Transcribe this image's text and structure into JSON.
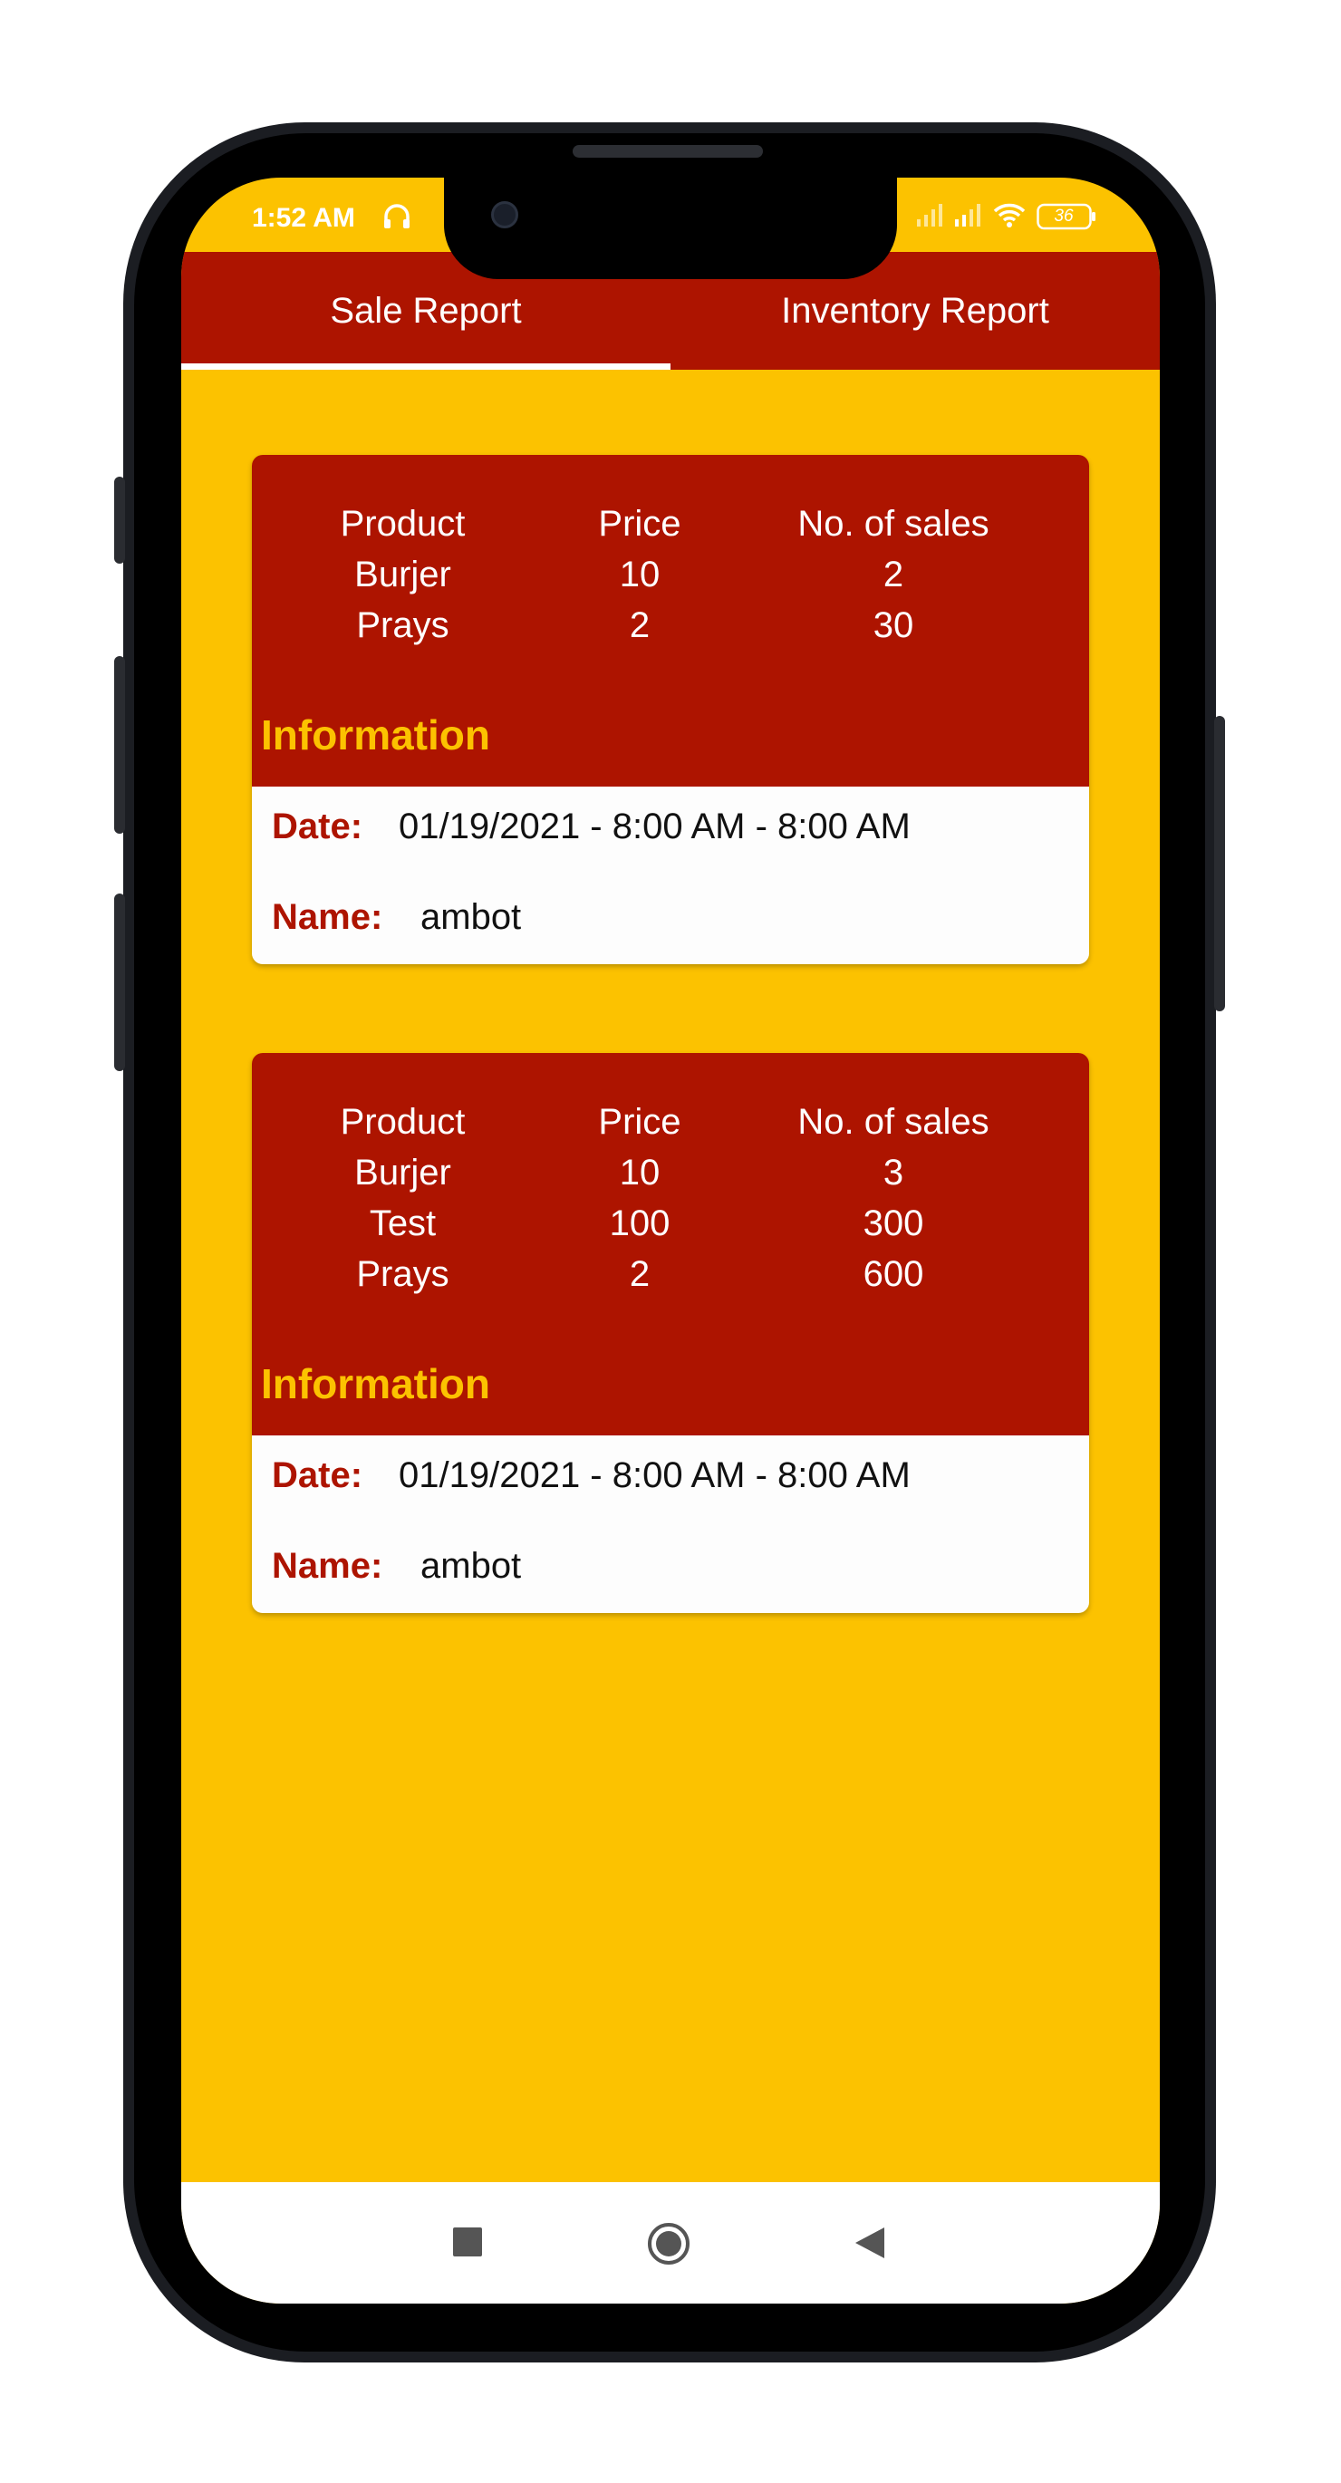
{
  "status_bar": {
    "time": "1:52 AM",
    "battery": "36",
    "icons": [
      "headphone-icon",
      "signal-icon",
      "signal-icon",
      "wifi-icon",
      "battery-icon"
    ]
  },
  "tabs": [
    {
      "label": "Sale Report",
      "selected": true
    },
    {
      "label": "Inventory Report",
      "selected": false
    }
  ],
  "reports": [
    {
      "headers": [
        "Product",
        "Price",
        "No. of sales"
      ],
      "rows": [
        [
          "Burjer",
          "10",
          "2"
        ],
        [
          "Prays",
          "2",
          "30"
        ]
      ],
      "info_title": "Information",
      "date_label": "Date:",
      "date_value": "01/19/2021 - 8:00 AM - 8:00 AM",
      "name_label": "Name:",
      "name_value": "ambot"
    },
    {
      "headers": [
        "Product",
        "Price",
        "No. of sales"
      ],
      "rows": [
        [
          "Burjer",
          "10",
          "3"
        ],
        [
          "Test",
          "100",
          "300"
        ],
        [
          "Prays",
          "2",
          "600"
        ]
      ],
      "info_title": "Information",
      "date_label": "Date:",
      "date_value": "01/19/2021 - 8:00 AM - 8:00 AM",
      "name_label": "Name:",
      "name_value": "ambot"
    }
  ],
  "nav": {
    "icons": [
      "recent-apps-icon",
      "home-icon",
      "back-icon"
    ]
  },
  "colors": {
    "accent": "#ad1400",
    "background": "#fcc200",
    "info_text": "#fcc200"
  }
}
